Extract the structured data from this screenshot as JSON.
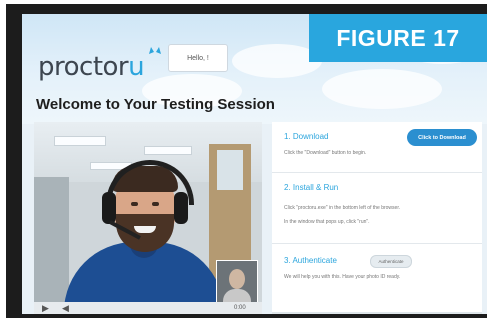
{
  "figure_label": "FIGURE 17",
  "app": {
    "logo_text": "proctor",
    "logo_accent": "u",
    "hello_tag": "Hello, !",
    "page_title": "Welcome to Your Testing Session"
  },
  "steps": [
    {
      "title": "1. Download",
      "desc": "Click the \"Download\" button to begin.",
      "button": "Click to Download"
    },
    {
      "title": "2. Install & Run",
      "desc": "Click \"proctoru.exe\" in the bottom left of the browser.",
      "desc2": "In the window that pops up, click \"run\"."
    },
    {
      "title": "3. Authenticate",
      "desc": "We will help you with this. Have your photo ID ready.",
      "button": "Authenticate"
    }
  ],
  "video_controls": {
    "play_icon": "play-icon",
    "mute_icon": "speaker-icon",
    "label": "0:00"
  },
  "colors": {
    "accent": "#2ba5dd",
    "banner": "#29a6de",
    "button": "#2b8fd0"
  }
}
